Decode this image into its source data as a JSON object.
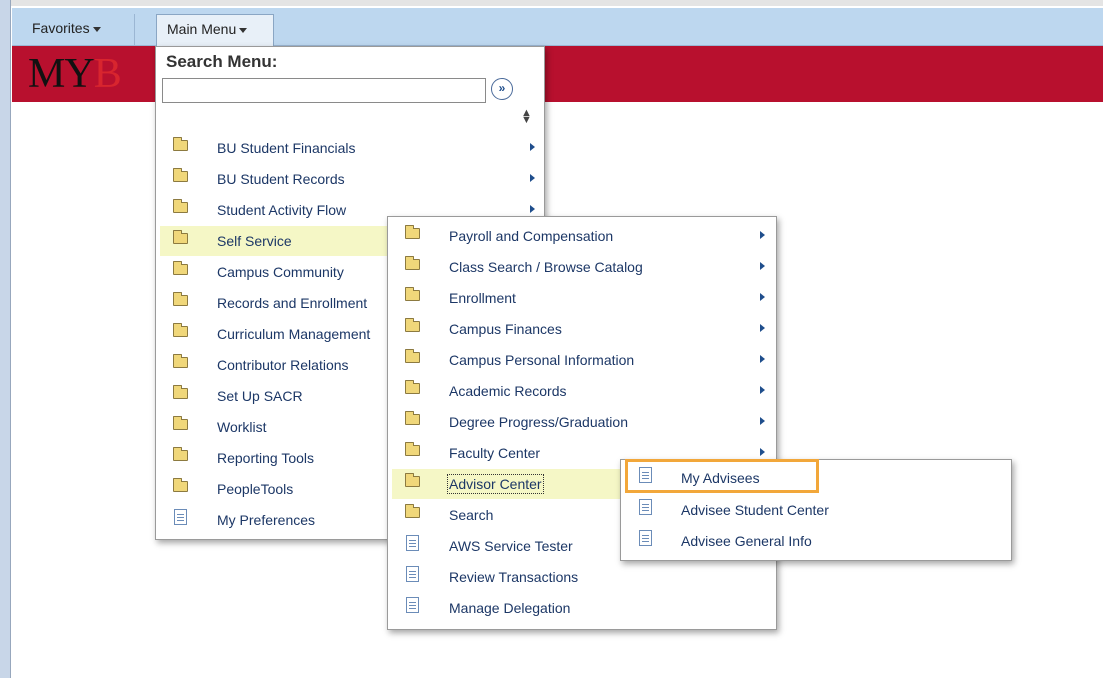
{
  "nav": {
    "favorites_label": "Favorites",
    "main_menu_label": "Main Menu"
  },
  "banner": {
    "logo_part1": "MY",
    "logo_part2": "B"
  },
  "menu1": {
    "search_title": "Search Menu:",
    "search_value": "",
    "search_go_glyph": "»",
    "items": [
      {
        "label": "BU Student Financials",
        "icon": "folder-icon",
        "submenu": true
      },
      {
        "label": "BU Student Records",
        "icon": "folder-icon",
        "submenu": true
      },
      {
        "label": "Student Activity Flow",
        "icon": "folder-icon",
        "submenu": true
      },
      {
        "label": "Self Service",
        "icon": "folder-icon",
        "submenu": true,
        "highlighted": true
      },
      {
        "label": "Campus Community",
        "icon": "folder-icon"
      },
      {
        "label": "Records and Enrollment",
        "icon": "folder-icon"
      },
      {
        "label": "Curriculum Management",
        "icon": "folder-icon"
      },
      {
        "label": "Contributor Relations",
        "icon": "folder-icon"
      },
      {
        "label": "Set Up SACR",
        "icon": "folder-icon"
      },
      {
        "label": "Worklist",
        "icon": "folder-icon"
      },
      {
        "label": "Reporting Tools",
        "icon": "folder-icon"
      },
      {
        "label": "PeopleTools",
        "icon": "folder-icon"
      },
      {
        "label": "My Preferences",
        "icon": "document-icon"
      }
    ]
  },
  "menu2": {
    "items": [
      {
        "label": "Payroll and Compensation",
        "icon": "folder-icon",
        "submenu": true
      },
      {
        "label": "Class Search / Browse Catalog",
        "icon": "folder-icon",
        "submenu": true
      },
      {
        "label": "Enrollment",
        "icon": "folder-icon",
        "submenu": true
      },
      {
        "label": "Campus Finances",
        "icon": "folder-icon",
        "submenu": true
      },
      {
        "label": "Campus Personal Information",
        "icon": "folder-icon",
        "submenu": true
      },
      {
        "label": "Academic Records",
        "icon": "folder-icon",
        "submenu": true
      },
      {
        "label": "Degree Progress/Graduation",
        "icon": "folder-icon",
        "submenu": true
      },
      {
        "label": "Faculty Center",
        "icon": "folder-icon",
        "submenu": true
      },
      {
        "label": "Advisor Center",
        "icon": "folder-icon",
        "submenu": true,
        "highlighted": true
      },
      {
        "label": "Search",
        "icon": "folder-icon"
      },
      {
        "label": "AWS Service Tester",
        "icon": "document-icon"
      },
      {
        "label": "Review Transactions",
        "icon": "document-icon"
      },
      {
        "label": "Manage Delegation",
        "icon": "document-icon"
      }
    ]
  },
  "menu3": {
    "items": [
      {
        "label": "My Advisees",
        "icon": "document-icon",
        "emphasized": true
      },
      {
        "label": "Advisee Student Center",
        "icon": "document-icon"
      },
      {
        "label": "Advisee General Info",
        "icon": "document-icon"
      }
    ]
  },
  "colors": {
    "banner": "#b8102e",
    "nav_bar": "#bdd7ef",
    "highlight": "#f5f7c6",
    "callout": "#f2a73a",
    "link_text": "#1c3766"
  }
}
